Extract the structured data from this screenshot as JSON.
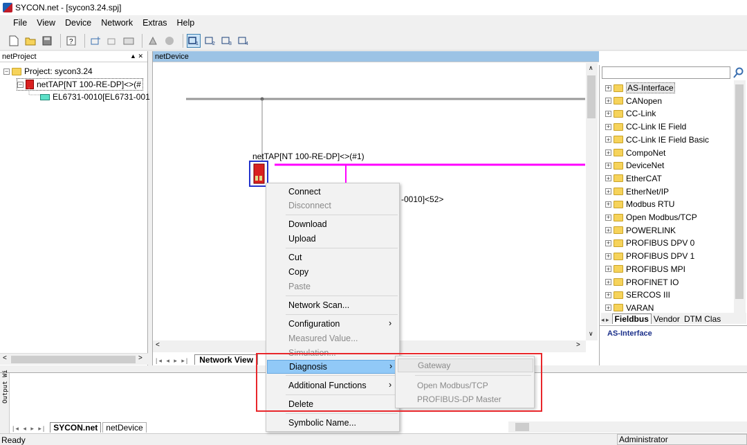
{
  "window": {
    "title": "SYCON.net - [sycon3.24.spj]"
  },
  "menu": [
    "File",
    "View",
    "Device",
    "Network",
    "Extras",
    "Help"
  ],
  "left_panel": {
    "title": "netProject",
    "project_label": "Project: sycon3.24",
    "device_label": "netTAP[NT 100-RE-DP]<>(#",
    "child_label": "EL6731-0010[EL6731-001"
  },
  "center": {
    "title": "netDevice",
    "device_caption": "netTAP[NT 100-RE-DP]<>(#1)",
    "slave_caption": "-0010]<52>",
    "tab_active": "Network View"
  },
  "catalog": {
    "search_placeholder": "",
    "items": [
      "AS-Interface",
      "CANopen",
      "CC-Link",
      "CC-Link IE Field",
      "CC-Link IE Field Basic",
      "CompoNet",
      "DeviceNet",
      "EtherCAT",
      "EtherNet/IP",
      "Modbus RTU",
      "Open Modbus/TCP",
      "POWERLINK",
      "PROFIBUS DPV 0",
      "PROFIBUS DPV 1",
      "PROFIBUS MPI",
      "PROFINET IO",
      "SERCOS III",
      "VARAN"
    ],
    "tabs": [
      "Fieldbus",
      "Vendor",
      "DTM Clas"
    ],
    "info": "AS-Interface"
  },
  "context_menu": {
    "connect": "Connect",
    "disconnect": "Disconnect",
    "download": "Download",
    "upload": "Upload",
    "cut": "Cut",
    "copy": "Copy",
    "paste": "Paste",
    "network_scan": "Network Scan...",
    "configuration": "Configuration",
    "measured_value": "Measured Value...",
    "simulation": "Simulation...",
    "diagnosis": "Diagnosis",
    "additional_functions": "Additional Functions",
    "delete": "Delete",
    "symbolic_name": "Symbolic Name..."
  },
  "submenu": {
    "gateway": "Gateway",
    "open_modbus": "Open Modbus/TCP",
    "profibus_master": "PROFIBUS-DP Master"
  },
  "output": {
    "side_label": "Output Wi",
    "tabs": [
      "SYCON.net",
      "netDevice"
    ]
  },
  "status": {
    "left": "Ready",
    "right": "Administrator"
  },
  "colors": {
    "highlight": "#91c9f7",
    "bus_magenta": "#ff00ff",
    "annotation_red": "#e8262a",
    "selection_blue": "#2233cc"
  }
}
